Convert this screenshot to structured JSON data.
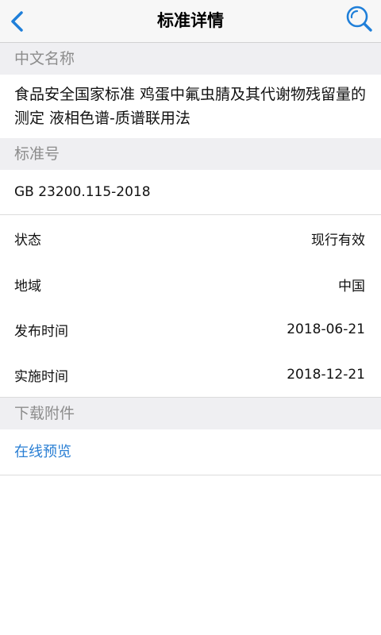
{
  "nav": {
    "title": "标准详情",
    "back_icon": "chevron-left-icon",
    "search_icon": "search-icon",
    "accent_color": "#1f7fd9"
  },
  "sections": {
    "chinese_name_header": "中文名称",
    "chinese_name_value": "食品安全国家标准 鸡蛋中氟虫腈及其代谢物残留量的测定 液相色谱-质谱联用法",
    "standard_no_header": "标准号",
    "standard_no_value": "GB 23200.115-2018",
    "details": [
      {
        "label": "状态",
        "value": "现行有效"
      },
      {
        "label": "地域",
        "value": "中国"
      },
      {
        "label": "发布时间",
        "value": "2018-06-21"
      },
      {
        "label": "实施时间",
        "value": "2018-12-21"
      }
    ],
    "attachments_header": "下载附件",
    "preview_link": "在线预览"
  }
}
